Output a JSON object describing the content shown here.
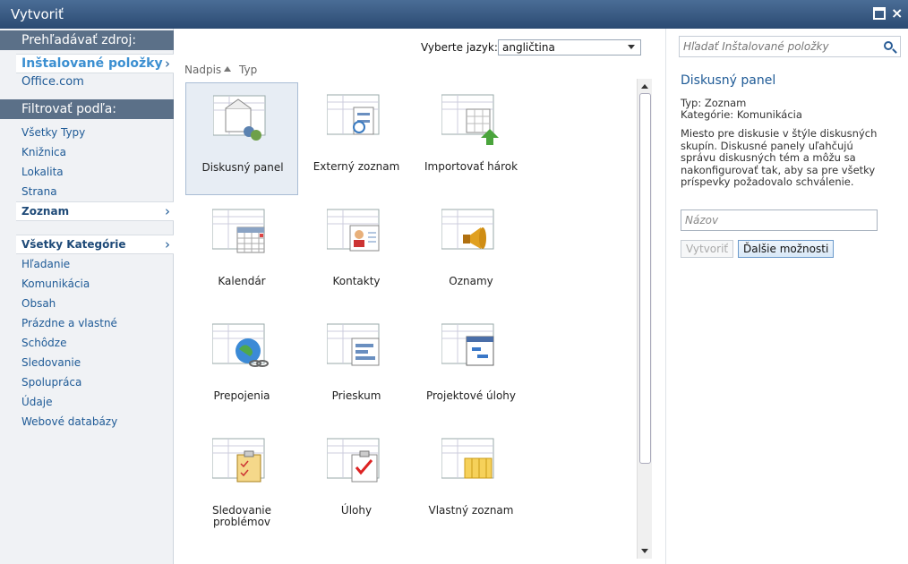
{
  "window": {
    "title": "Vytvoriť"
  },
  "leftnav": {
    "browse_header": "Prehľadávať zdroj:",
    "sources": [
      {
        "label": "Inštalované položky",
        "selected": true
      },
      {
        "label": "Office.com",
        "selected": false
      }
    ],
    "filter_header": "Filtrovať podľa:",
    "types": [
      "Všetky Typy",
      "Knižnica",
      "Lokalita",
      "Strana",
      "Zoznam"
    ],
    "selected_type": "Zoznam",
    "categories_selected": "Všetky Kategórie",
    "categories": [
      "Hľadanie",
      "Komunikácia",
      "Obsah",
      "Prázdne a vlastné",
      "Schôdze",
      "Sledovanie",
      "Spolupráca",
      "Údaje",
      "Webové databázy"
    ]
  },
  "toolbar": {
    "language_label": "Vyberte jazyk:",
    "language_value": "angličtina",
    "sort_title": "Nadpis",
    "sort_type": "Typ"
  },
  "tiles": [
    {
      "label": "Diskusný panel",
      "icon": "discussion-board-icon",
      "selected": true
    },
    {
      "label": "Externý zoznam",
      "icon": "external-list-icon"
    },
    {
      "label": "Importovať hárok",
      "icon": "import-spreadsheet-icon"
    },
    {
      "label": "Kalendár",
      "icon": "calendar-icon"
    },
    {
      "label": "Kontakty",
      "icon": "contacts-icon"
    },
    {
      "label": "Oznamy",
      "icon": "announcements-icon"
    },
    {
      "label": "Prepojenia",
      "icon": "links-icon"
    },
    {
      "label": "Prieskum",
      "icon": "survey-icon"
    },
    {
      "label": "Projektové úlohy",
      "icon": "project-tasks-icon"
    },
    {
      "label": "Sledovanie problémov",
      "icon": "issue-tracking-icon"
    },
    {
      "label": "Úlohy",
      "icon": "tasks-icon"
    },
    {
      "label": "Vlastný zoznam",
      "icon": "custom-list-icon"
    }
  ],
  "details": {
    "search_placeholder": "Hľadať Inštalované položky",
    "title": "Diskusný panel",
    "type_line": "Typ: Zoznam",
    "category_line": "Kategórie: Komunikácia",
    "description": "Miesto pre diskusie v štýle diskusných skupín. Diskusné panely uľahčujú správu diskusných tém a môžu sa nakonfigurovať tak, aby sa pre všetky príspevky požadovalo schválenie.",
    "name_placeholder": "Názov",
    "create_button": "Vytvoriť",
    "more_button": "Ďalšie možnosti"
  },
  "colors": {
    "title_bar": "#2b4a72",
    "nav_header": "#5b7088",
    "link": "#1e5a96",
    "accent": "#3b8fd1"
  }
}
